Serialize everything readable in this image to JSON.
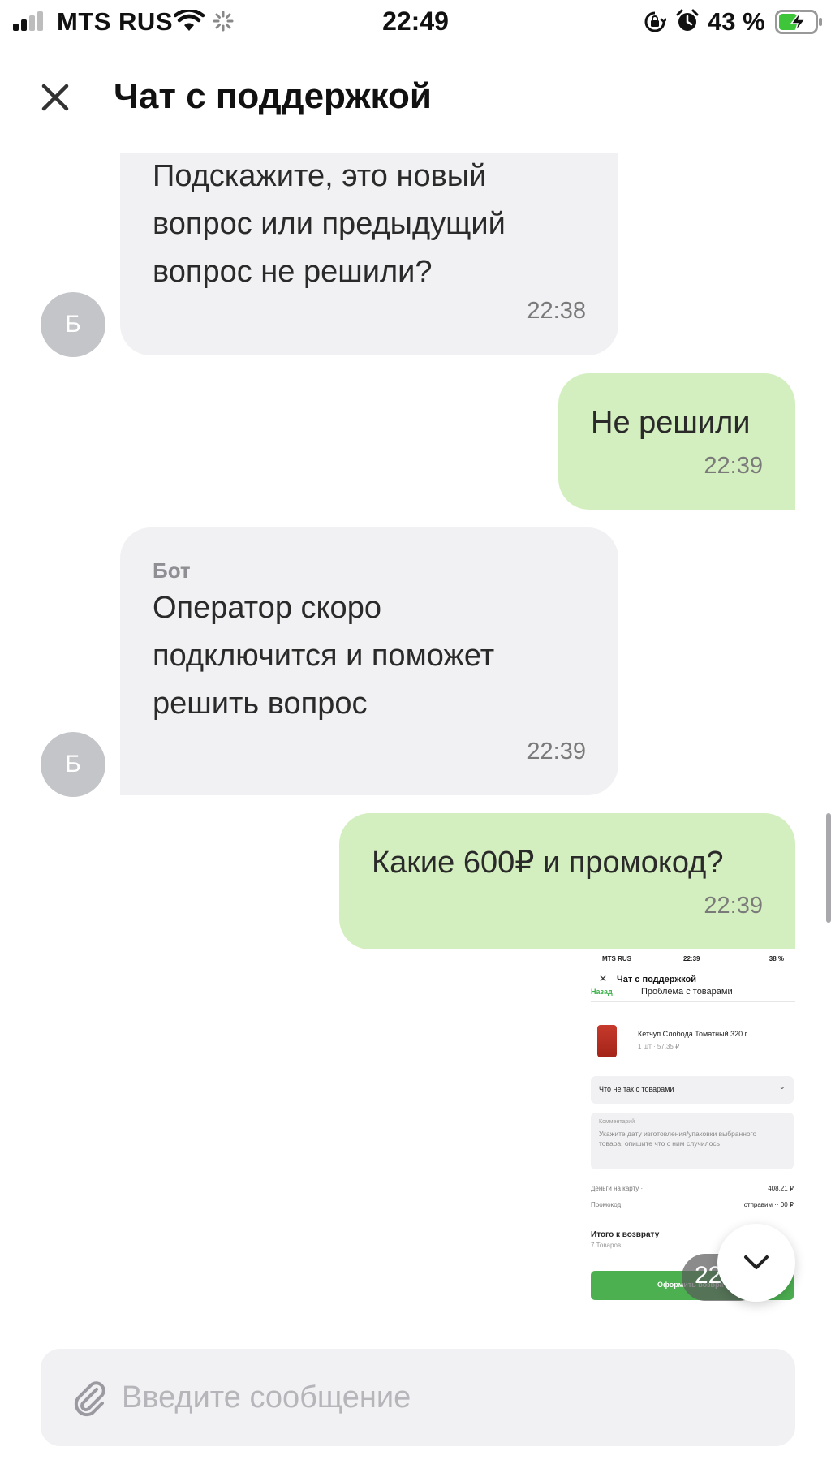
{
  "status_bar": {
    "carrier": "MTS RUS",
    "time": "22:49",
    "battery": "43 %",
    "icons": [
      "signal-icon",
      "wifi-icon",
      "activity-icon",
      "orientation-lock-icon",
      "alarm-icon",
      "battery-charging-icon"
    ]
  },
  "header": {
    "title": "Чат с поддержкой",
    "close_icon": "close-icon"
  },
  "messages": [
    {
      "direction": "incoming",
      "sender": "",
      "text": "Подскажите, это новый\nвопрос или предыдущий\nвопрос не решили?",
      "time": "22:38",
      "avatar": "Б"
    },
    {
      "direction": "outgoing",
      "text": "Не решили",
      "time": "22:39"
    },
    {
      "direction": "incoming",
      "sender": "Бот",
      "text": "Оператор скоро\nподключится и поможет\nрешить вопрос",
      "time": "22:39",
      "avatar": "Б"
    },
    {
      "direction": "outgoing",
      "text": "Какие 600₽ и промокод?",
      "time": "22:39"
    }
  ],
  "attachment": {
    "type": "screenshot",
    "status_left": "MTS RUS",
    "status_time": "22:39",
    "status_right": "38 %",
    "title": "Чат с поддержкой",
    "back_label": "Назад",
    "subtitle": "Проблема с товарами",
    "product_name": "Кетчуп Слобода Томатный 320 г",
    "product_meta": "1 шт · 57,35 ₽",
    "select_label": "Что не так с товарами",
    "comment_label": "Комментарий",
    "comment_placeholder": "Укажите дату изготовления/упаковки выбранного товара, опишите что с ним случилось",
    "money_label": "Деньги на карту ··",
    "money_value": "408,21 ₽",
    "promo_label": "Промокод",
    "promo_value": "отправим ·· 00 ₽",
    "total_label": "Итого к возврату",
    "total_sub": "7 Товаров",
    "button_label": "Оформить возврат",
    "time_partial": "22"
  },
  "scroll_button_icon": "chevron-down-icon",
  "composer": {
    "placeholder": "Введите сообщение",
    "attach_icon": "paperclip-icon"
  },
  "colors": {
    "incoming_bubble": "#f1f1f3",
    "outgoing_bubble": "#d4efbf",
    "avatar": "#c4c5c9",
    "accent_green": "#4caf50"
  }
}
